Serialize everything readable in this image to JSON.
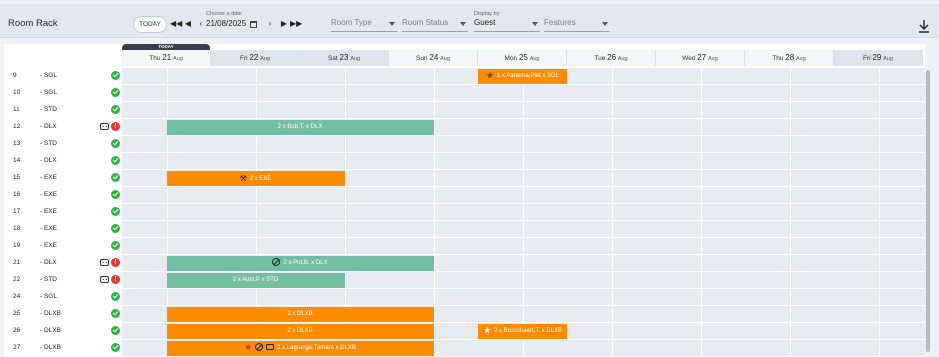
{
  "header": {
    "title": "Room Rack",
    "today_label": "TODAY",
    "date_label": "Choose a date",
    "date_value": "21/08/2025",
    "room_type_placeholder": "Room Type",
    "room_status_placeholder": "Room Status",
    "display_by_label": "Display by",
    "display_by_value": "Guest",
    "features_placeholder": "Features"
  },
  "today_tag": "TODAY",
  "days": [
    {
      "dow": "Thu",
      "num": "21",
      "mon": "Aug",
      "today": true
    },
    {
      "dow": "Fri",
      "num": "22",
      "mon": "Aug"
    },
    {
      "dow": "Sat",
      "num": "23",
      "mon": "Aug"
    },
    {
      "dow": "Sun",
      "num": "24",
      "mon": "Aug"
    },
    {
      "dow": "Mon",
      "num": "25",
      "mon": "Aug"
    },
    {
      "dow": "Tue",
      "num": "26",
      "mon": "Aug"
    },
    {
      "dow": "Wed",
      "num": "27",
      "mon": "Aug"
    },
    {
      "dow": "Thu",
      "num": "28",
      "mon": "Aug"
    },
    {
      "dow": "Fri",
      "num": "29",
      "mon": "Aug"
    }
  ],
  "rooms": [
    {
      "num": "9",
      "type": "- SGL",
      "status": "ok"
    },
    {
      "num": "10",
      "type": "- SGL",
      "status": "ok"
    },
    {
      "num": "11",
      "type": "- STD",
      "status": "ok"
    },
    {
      "num": "12",
      "type": "- DLX",
      "status": "warn",
      "robot": true
    },
    {
      "num": "13",
      "type": "- STD",
      "status": "ok"
    },
    {
      "num": "14",
      "type": "- DLX",
      "status": "ok"
    },
    {
      "num": "15",
      "type": "- EXE",
      "status": "ok"
    },
    {
      "num": "16",
      "type": "- EXE",
      "status": "ok"
    },
    {
      "num": "17",
      "type": "- EXE",
      "status": "ok"
    },
    {
      "num": "18",
      "type": "- EXE",
      "status": "ok"
    },
    {
      "num": "19",
      "type": "- EXE",
      "status": "ok"
    },
    {
      "num": "21",
      "type": "- DLX",
      "status": "warn",
      "robot": true
    },
    {
      "num": "22",
      "type": "- STD",
      "status": "warn",
      "robot": true
    },
    {
      "num": "24",
      "type": "- SGL",
      "status": "ok"
    },
    {
      "num": "25",
      "type": "- DLXB",
      "status": "ok"
    },
    {
      "num": "26",
      "type": "- DLXB",
      "status": "ok"
    },
    {
      "num": "27",
      "type": "- DLXB",
      "status": "ok"
    }
  ],
  "bookings": [
    {
      "row": 0,
      "start": 4.0,
      "end": 5.0,
      "color": "orange",
      "label": "1 x Aanema,Piet x SGL",
      "icons": [
        "star-dark"
      ]
    },
    {
      "row": 3,
      "start": 0.5,
      "end": 3.5,
      "color": "green",
      "label": "2 x Bob,T. x DLX",
      "icons": []
    },
    {
      "row": 6,
      "start": 0.5,
      "end": 2.5,
      "color": "orange",
      "label": "2 x EXE",
      "icons": [
        "bed"
      ]
    },
    {
      "row": 11,
      "start": 0.5,
      "end": 3.5,
      "color": "green",
      "label": "2 x Pot,B. x DLX",
      "icons": [
        "no-entry"
      ]
    },
    {
      "row": 12,
      "start": 0.5,
      "end": 2.5,
      "color": "green",
      "label": "2 x Auto,P x STD",
      "icons": []
    },
    {
      "row": 14,
      "start": 0.5,
      "end": 3.5,
      "color": "orange",
      "label": "2 x DLXB",
      "icons": []
    },
    {
      "row": 15,
      "start": 0.5,
      "end": 3.5,
      "color": "orange",
      "label": "2 x DLXB",
      "icons": []
    },
    {
      "row": 15,
      "start": 4.0,
      "end": 5.0,
      "color": "orange",
      "label": "2 x Bosschaert,T. x DLXB",
      "icons": [
        "star-white"
      ]
    },
    {
      "row": 16,
      "start": 0.5,
      "end": 3.5,
      "color": "orange",
      "label": "2 x Lagrange,Tamara x DLXB",
      "icons": [
        "star-red",
        "no-entry",
        "horn"
      ]
    }
  ],
  "colors": {
    "green": "#74bfa4",
    "orange": "#ff8c00",
    "ok": "#2fb344",
    "warn": "#e53935"
  }
}
